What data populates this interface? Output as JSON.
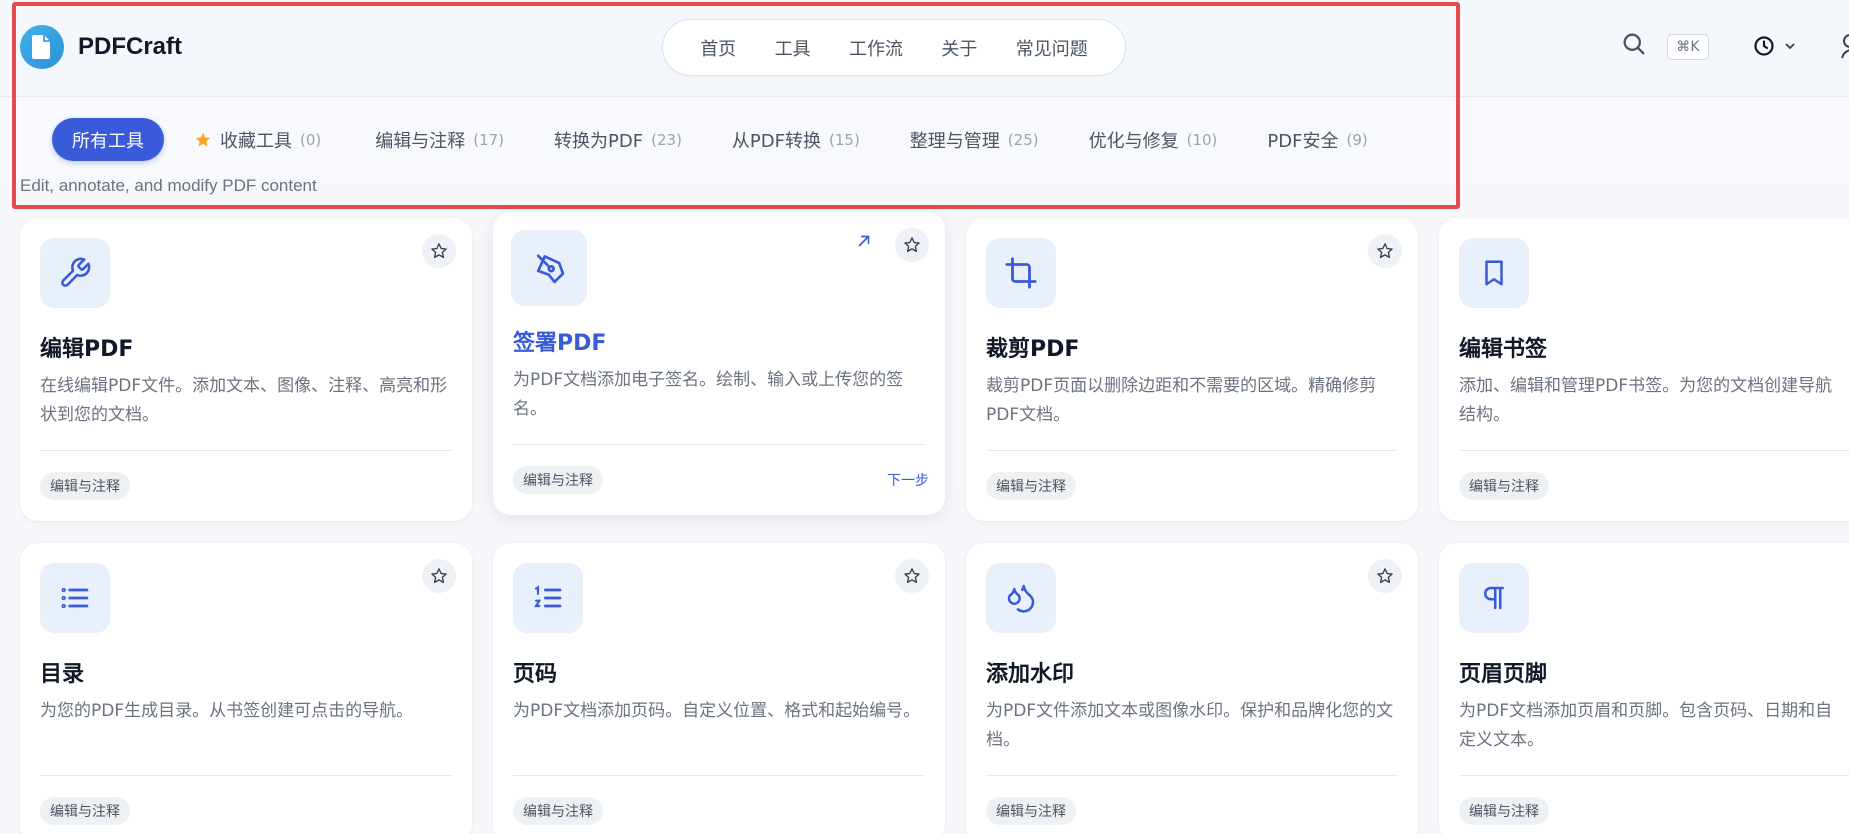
{
  "brand": {
    "name": "PDFCraft"
  },
  "nav": [
    {
      "label": "首页"
    },
    {
      "label": "工具"
    },
    {
      "label": "工作流"
    },
    {
      "label": "关于"
    },
    {
      "label": "常见问题"
    }
  ],
  "header": {
    "shortcut": "⌘K"
  },
  "tabs": [
    {
      "label": "所有工具",
      "count": ""
    },
    {
      "label": "收藏工具",
      "count": "(0)"
    },
    {
      "label": "编辑与注释",
      "count": "(17)"
    },
    {
      "label": "转换为PDF",
      "count": "(23)"
    },
    {
      "label": "从PDF转换",
      "count": "(15)"
    },
    {
      "label": "整理与管理",
      "count": "(25)"
    },
    {
      "label": "优化与修复",
      "count": "(10)"
    },
    {
      "label": "PDF安全",
      "count": "(9)"
    }
  ],
  "section": {
    "subtitle": "Edit, annotate, and modify PDF content"
  },
  "cards": [
    {
      "title": "编辑PDF",
      "desc": "在线编辑PDF文件。添加文本、图像、注释、高亮和形状到您的文档。",
      "tag": "编辑与注释",
      "icon": "wrench-icon"
    },
    {
      "title": "签署PDF",
      "desc": "为PDF文档添加电子签名。绘制、输入或上传您的签名。",
      "tag": "编辑与注释",
      "icon": "pen-nib-icon",
      "next": "下一步"
    },
    {
      "title": "裁剪PDF",
      "desc": "裁剪PDF页面以删除边距和不需要的区域。精确修剪PDF文档。",
      "tag": "编辑与注释",
      "icon": "crop-icon"
    },
    {
      "title": "编辑书签",
      "desc": "添加、编辑和管理PDF书签。为您的文档创建导航结构。",
      "tag": "编辑与注释",
      "icon": "bookmark-icon"
    },
    {
      "title": "目录",
      "desc": "为您的PDF生成目录。从书签创建可点击的导航。",
      "tag": "编辑与注释",
      "icon": "list-icon"
    },
    {
      "title": "页码",
      "desc": "为PDF文档添加页码。自定义位置、格式和起始编号。",
      "tag": "编辑与注释",
      "icon": "numbered-list-icon"
    },
    {
      "title": "添加水印",
      "desc": "为PDF文件添加文本或图像水印。保护和品牌化您的文档。",
      "tag": "编辑与注释",
      "icon": "droplets-icon"
    },
    {
      "title": "页眉页脚",
      "desc": "为PDF文档添加页眉和页脚。包含页码、日期和自定义文本。",
      "tag": "编辑与注释",
      "icon": "pilcrow-icon"
    }
  ],
  "colors": {
    "accent": "#3a5bd9",
    "highlight": "#e5484d",
    "star": "#f5a524"
  }
}
